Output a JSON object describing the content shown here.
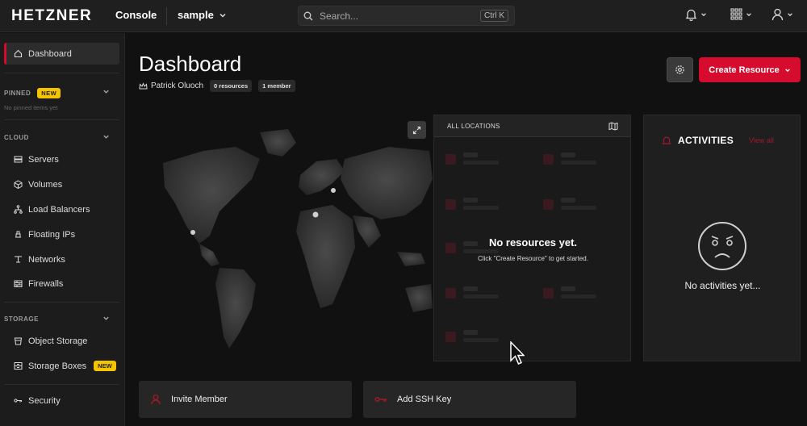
{
  "topbar": {
    "brand": "HETZNER",
    "brand_sub": "Console",
    "project": "sample",
    "search_placeholder": "Search...",
    "search_shortcut": "Ctrl K",
    "icons": [
      "bell-icon",
      "chevron-down-icon",
      "apps-grid-icon",
      "user-icon"
    ]
  },
  "sidebar": {
    "dashboard": "Dashboard",
    "pinned": {
      "title": "PINNED",
      "badge": "NEW",
      "empty": "No pinned items yet"
    },
    "cloud": {
      "title": "CLOUD",
      "items": [
        "Servers",
        "Volumes",
        "Load Balancers",
        "Floating IPs",
        "Networks",
        "Firewalls"
      ]
    },
    "storage": {
      "title": "STORAGE",
      "items": [
        "Object Storage",
        "Storage Boxes"
      ],
      "storage_boxes_badge": "NEW"
    },
    "security": "Security"
  },
  "main": {
    "title": "Dashboard",
    "owner": "Patrick Oluoch",
    "resources_chip": "0 resources",
    "members_chip": "1 member",
    "create_button": "Create Resource",
    "locations": {
      "header": "ALL LOCATIONS",
      "empty_title": "No resources yet.",
      "empty_sub": "Click \"Create Resource\" to get started."
    },
    "activities": {
      "title": "ACTIVITIES",
      "view_all": "View all",
      "empty": "No activities yet..."
    },
    "actions": {
      "invite": "Invite Member",
      "ssh": "Add SSH Key"
    }
  },
  "colors": {
    "accent": "#d50c2d",
    "badge": "#f5c400",
    "bg": "#111111",
    "panel": "#1f1f1f"
  }
}
